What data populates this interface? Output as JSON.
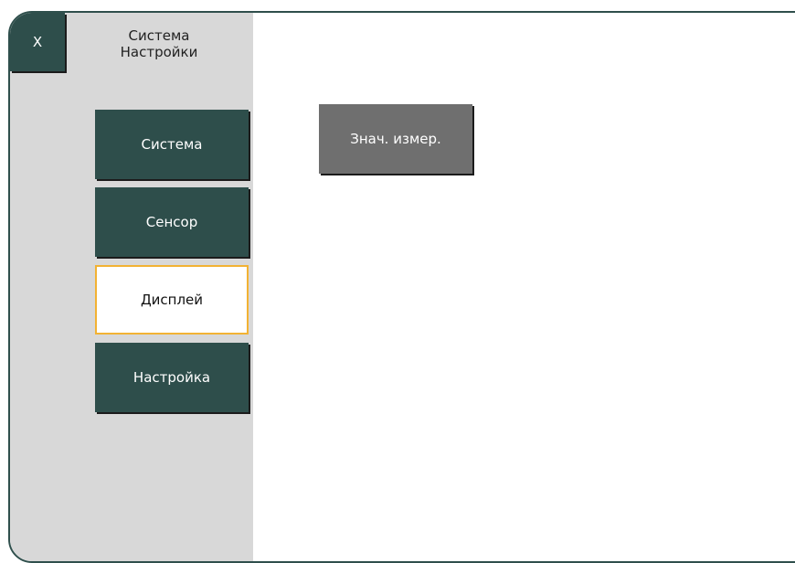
{
  "window": {
    "close_label": "X",
    "title_line1": "Система",
    "title_line2": "Настройки"
  },
  "sidebar": {
    "items": [
      {
        "label": "Система",
        "active": false
      },
      {
        "label": "Сенсор",
        "active": false
      },
      {
        "label": "Дисплей",
        "active": true
      },
      {
        "label": "Настройка",
        "active": false
      }
    ]
  },
  "main": {
    "button_label": "Знач. измер."
  },
  "colors": {
    "accent": "#2e4e4b",
    "sidebar_bg": "#d8d8d8",
    "active_border": "#f2b233",
    "content_button": "#6f6f6f"
  }
}
